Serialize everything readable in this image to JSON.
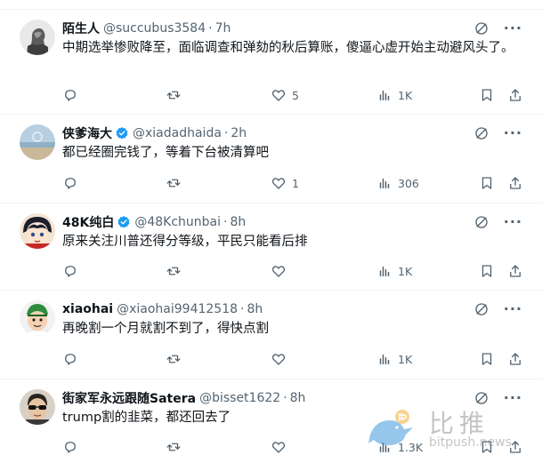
{
  "tweets": [
    {
      "name": "陌生人",
      "handle": "@succubus3584",
      "time": "7h",
      "verified": false,
      "text": "中期选举惨败降至，面临调查和弹劾的秋后算账，傻逼心虚开始主动避风头了。",
      "reply_count": "",
      "retweet_count": "",
      "like_count": "5",
      "view_count": "1K",
      "avatar": "avatar-statue"
    },
    {
      "name": "侠爹海大",
      "handle": "@xiadadhaida",
      "time": "2h",
      "verified": true,
      "text": "都已经圈完钱了，等着下台被清算吧",
      "reply_count": "",
      "retweet_count": "",
      "like_count": "1",
      "view_count": "306",
      "avatar": "avatar-sea"
    },
    {
      "name": "48K纯白",
      "handle": "@48Kchunbai",
      "time": "8h",
      "verified": true,
      "text": "原来关注川普还得分等级，平民只能看后排",
      "reply_count": "",
      "retweet_count": "",
      "like_count": "",
      "view_count": "1K",
      "avatar": "avatar-anime"
    },
    {
      "name": "xiaohai",
      "handle": "@xiaohai99412518",
      "time": "8h",
      "verified": false,
      "text": "再晚割一个月就割不到了，得快点割",
      "reply_count": "",
      "retweet_count": "",
      "like_count": "",
      "view_count": "1K",
      "avatar": "avatar-cartoon"
    },
    {
      "name": "街家军永远跟随Satera",
      "handle": "@bisset1622",
      "time": "8h",
      "verified": false,
      "text": "trump割的韭菜，都还回去了",
      "reply_count": "",
      "retweet_count": "",
      "like_count": "",
      "view_count": "1.3K",
      "avatar": "avatar-sunglasses"
    }
  ],
  "separator": "·",
  "more_glyph": "···",
  "watermark": {
    "title": "比推",
    "subtitle": "bitpush.news"
  },
  "colors": {
    "text": "#0f1419",
    "secondary": "#536471",
    "verified": "#1d9bf0",
    "divider": "#eff3f4"
  }
}
